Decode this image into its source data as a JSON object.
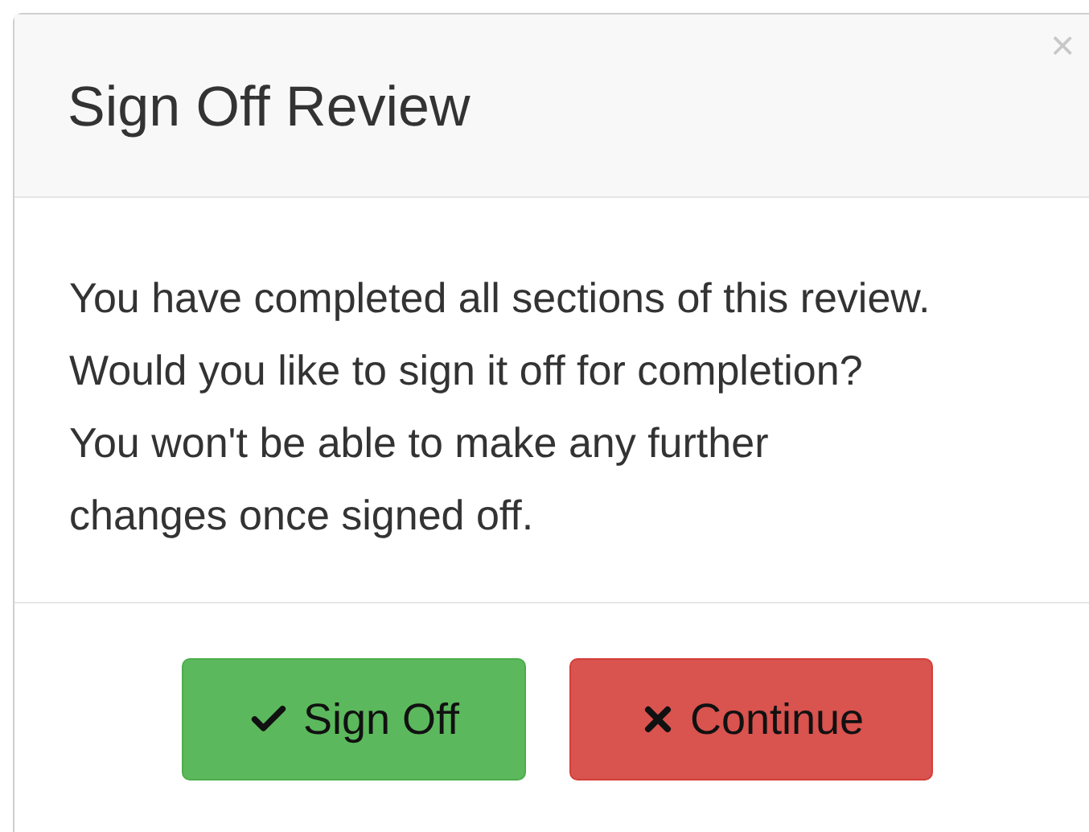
{
  "dialog": {
    "title": "Sign Off Review",
    "close": "×",
    "message": "You have completed all sections of this review. Would you like to sign it off for completion? You won't be able to make any further changes once signed off.",
    "buttons": [
      {
        "label": "Sign Off",
        "kind": "confirm"
      },
      {
        "label": "Continue",
        "kind": "cancel"
      }
    ]
  }
}
